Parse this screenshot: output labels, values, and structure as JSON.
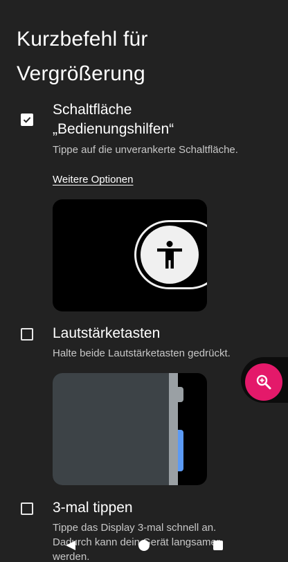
{
  "page": {
    "title": "Kurzbefehl für Vergrößerung"
  },
  "options": [
    {
      "title_line1": "Schaltfläche",
      "title_line2": "„Bedienungshilfen“",
      "subtitle": "Tippe auf die unverankerte Schaltfläche.",
      "link": "Weitere Optionen",
      "checked": true
    },
    {
      "title": "Lautstärketasten",
      "subtitle": "Halte beide Lautstärketasten gedrückt.",
      "checked": false
    },
    {
      "title": "3-mal tippen",
      "subtitle_line1": "Tippe das Display 3-mal schnell an.",
      "subtitle_line2": "Dadurch kann dein Gerät langsamer",
      "subtitle_line3": "werden.",
      "checked": false
    }
  ],
  "icons": {
    "checkbox_checked": "check-icon",
    "preview_a11y": "accessibility-icon",
    "floating_button": "magnify-plus-icon",
    "nav_back": "back-triangle-icon",
    "nav_home": "home-circle-icon",
    "nav_recent": "recents-square-icon"
  },
  "colors": {
    "background": "#222222",
    "accent_fab": "#e4196a",
    "volume_key_highlight": "#5b9af5"
  }
}
